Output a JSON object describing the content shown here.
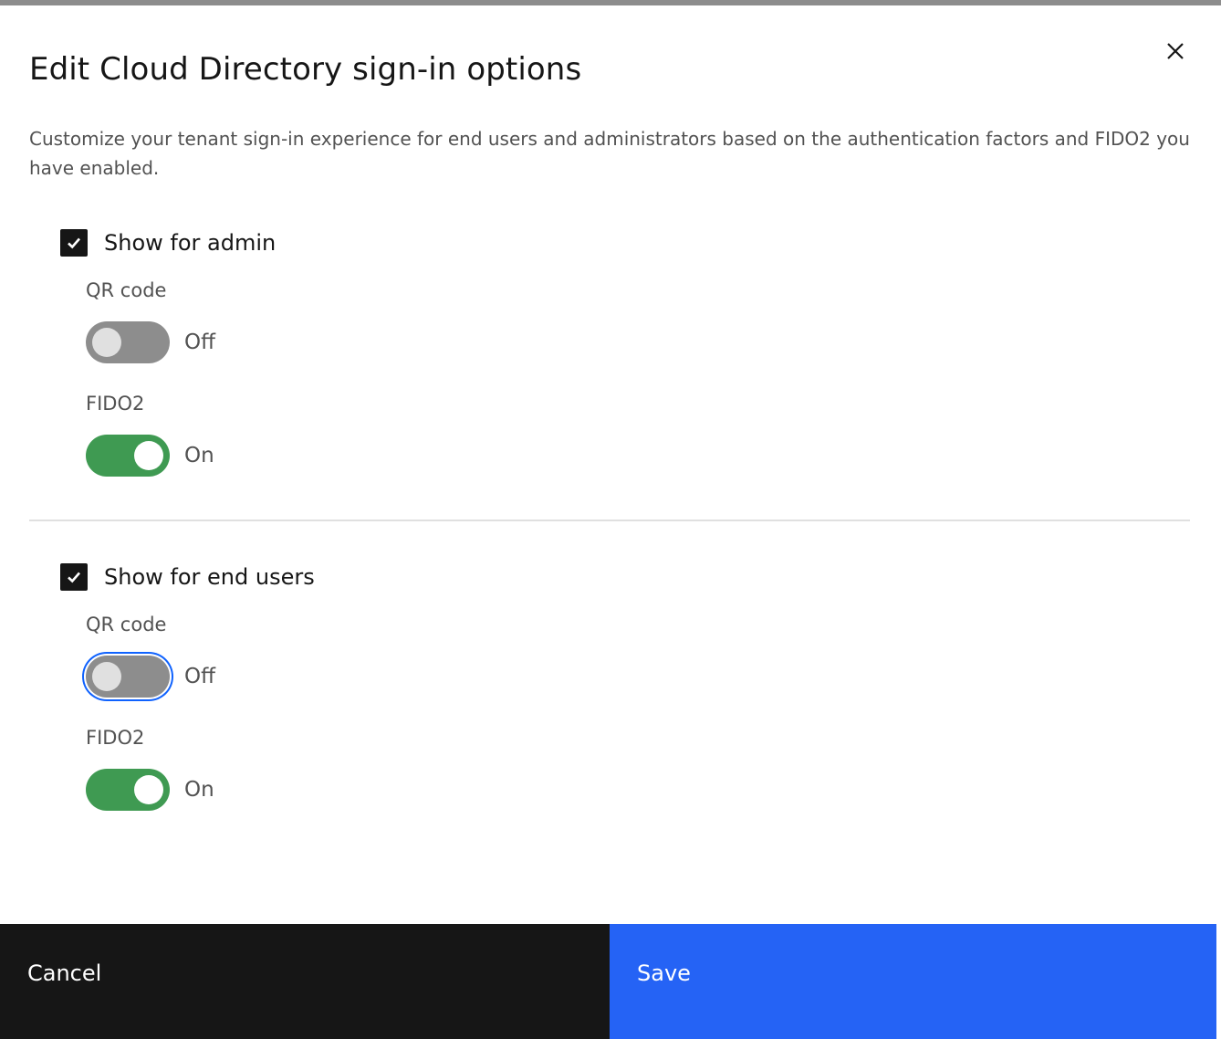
{
  "modal": {
    "title": "Edit Cloud Directory sign-in options",
    "description": "Customize your tenant sign-in experience for end users and administrators based on the authentication factors and FIDO2 you have enabled.",
    "close_icon": "close-icon"
  },
  "admin": {
    "checkbox_label": "Show for admin",
    "checked": true,
    "qr_label": "QR code",
    "qr_state": "Off",
    "fido_label": "FIDO2",
    "fido_state": "On"
  },
  "users": {
    "checkbox_label": "Show for end users",
    "checked": true,
    "qr_label": "QR code",
    "qr_state": "Off",
    "fido_label": "FIDO2",
    "fido_state": "On"
  },
  "footer": {
    "cancel_label": "Cancel",
    "save_label": "Save"
  },
  "colors": {
    "toggle_on": "#3f9a52",
    "toggle_off": "#8d8d8d",
    "primary": "#2563f5",
    "secondary": "#161616",
    "focus": "#0f62fe"
  }
}
